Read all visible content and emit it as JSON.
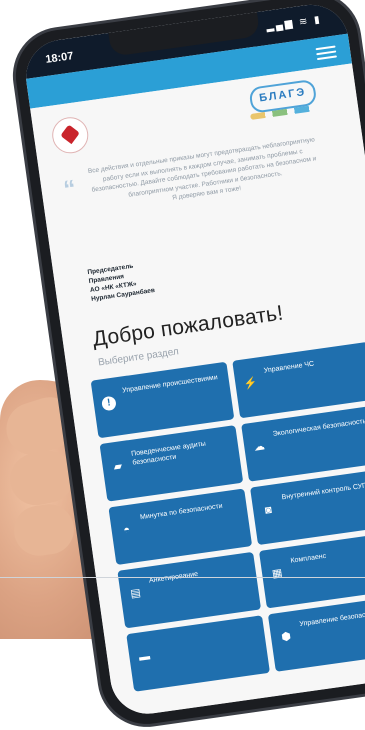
{
  "status": {
    "time": "18:07",
    "signal": "▂▄▆ ≋ ▮"
  },
  "header": {
    "menu_icon": "hamburger-icon",
    "logo_text": "БЛАГЭ"
  },
  "intro": {
    "quote": "Все действия и отдельные приказы могут предотвращать неблагоприятную работу если их выполнять в каждом случае, занимать проблемы с безопасностью. Давайте соблюдать требования работать на безопасном и благоприятном участке. Работники и безопасность.",
    "closing": "Я доверяю вам я тоже!",
    "signature": [
      "Председатель",
      "Правления",
      "АО «НК «КТЖ»",
      "Нурлан Сауранбаев"
    ]
  },
  "welcome": {
    "title": "Добро пожаловать!",
    "subtitle": "Выберите раздел"
  },
  "sections": [
    {
      "label": "Управление происшествиями",
      "icon": "alert-icon",
      "glyph": "!"
    },
    {
      "label": "Управление ЧС",
      "icon": "lightning-icon",
      "glyph": "⚡"
    },
    {
      "label": "Поведенческие аудиты безопасности",
      "icon": "chat-icon",
      "glyph": "▰"
    },
    {
      "label": "Экологическая безопасность",
      "icon": "cloud-icon",
      "glyph": "☁"
    },
    {
      "label": "Минутка по безопасности",
      "icon": "helmet-icon",
      "glyph": "◓"
    },
    {
      "label": "Внутренний контроль СУПБ",
      "icon": "camera-icon",
      "glyph": "◙"
    },
    {
      "label": "Анкетирование",
      "icon": "clipboard-icon",
      "glyph": "▤"
    },
    {
      "label": "Комплаенс",
      "icon": "document-icon",
      "glyph": "▦"
    },
    {
      "label": "",
      "icon": "folder-icon",
      "glyph": "▬"
    },
    {
      "label": "Управление безопасностью",
      "icon": "shield-icon",
      "glyph": "⬢"
    }
  ]
}
